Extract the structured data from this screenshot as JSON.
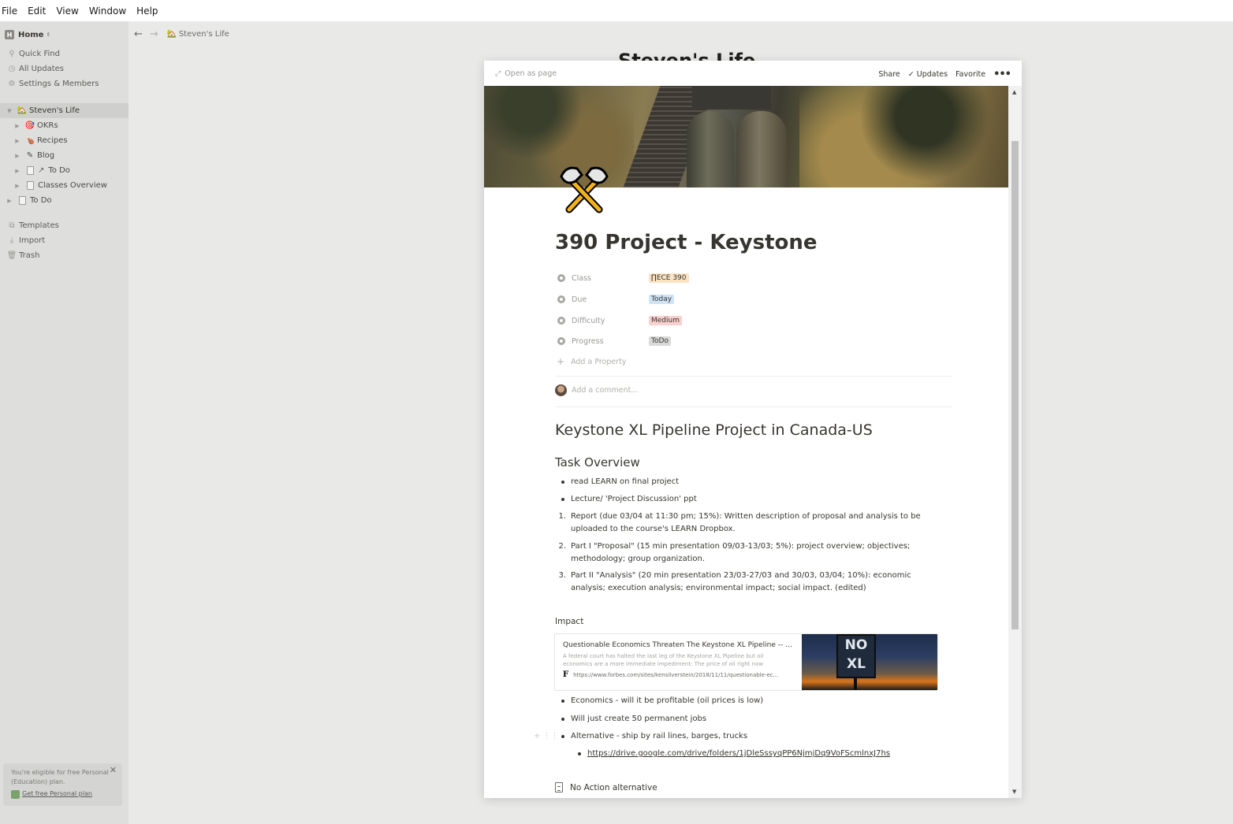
{
  "menubar": [
    "File",
    "Edit",
    "View",
    "Window",
    "Help"
  ],
  "sidebar": {
    "workspace": "Home",
    "items": [
      {
        "label": "Quick Find",
        "icon": "search-icon"
      },
      {
        "label": "All Updates",
        "icon": "clock-icon"
      },
      {
        "label": "Settings & Members",
        "icon": "gear-icon"
      }
    ],
    "tree": [
      {
        "label": "Steven's Life",
        "icon": "house-emoji",
        "active": true
      },
      {
        "label": "OKRs",
        "icon": "target-emoji"
      },
      {
        "label": "Recipes",
        "icon": "drumstick-emoji"
      },
      {
        "label": "Blog",
        "icon": "pencil-emoji"
      },
      {
        "label": "To Do",
        "icon": "page-icon"
      },
      {
        "label": "Classes Overview",
        "icon": "page-icon"
      },
      {
        "label": "To Do",
        "icon": "page-icon"
      }
    ],
    "bottom": [
      {
        "label": "Templates",
        "icon": "templates-icon"
      },
      {
        "label": "Import",
        "icon": "import-icon"
      },
      {
        "label": "Trash",
        "icon": "trash-icon"
      }
    ],
    "promo": {
      "text": "You're eligible for free Personal (Education) plan.",
      "link": "Get free Personal plan"
    }
  },
  "topbar": {
    "breadcrumb": "Steven's Life"
  },
  "background_title": "Steven's Life",
  "modal": {
    "open_as_page": "Open as page",
    "share": "Share",
    "updates": "Updates",
    "favorite": "Favorite",
    "title": "390 Project - Keystone",
    "properties": [
      {
        "name": "Class",
        "value": "ECE 390",
        "color": "#fae3c5"
      },
      {
        "name": "Due",
        "value": "Today",
        "color": "#cfe3f6"
      },
      {
        "name": "Difficulty",
        "value": "Medium",
        "color": "#f8d0cf"
      },
      {
        "name": "Progress",
        "value": "ToDo",
        "color": "#d9d9d7"
      }
    ],
    "add_property": "Add a Property",
    "comment_placeholder": "Add a comment...",
    "heading1": "Keystone XL Pipeline Project in Canada-US",
    "heading2": "Task Overview",
    "bullets": [
      "read LEARN on final project",
      "Lecture/ 'Project Discussion' ppt"
    ],
    "numbered": [
      "Report (due 03/04 at 11:30 pm; 15%): Written description of proposal and analysis to be uploaded to the course's LEARN Dropbox.",
      "Part I \"Proposal\" (15 min presentation  09/03-13/03; 5%): project overview; objectives; methodology; group organization.",
      "Part II \"Analysis\" (20 min presentation 23/03-27/03 and 30/03, 03/04; 10%): economic analysis; execution analysis; environmental impact; social impact. (edited)"
    ],
    "impact_label": "Impact",
    "bookmark": {
      "title": "Questionable Economics Threaten The Keystone XL Pipeline -- No...",
      "description": "A federal court has halted the last leg of the Keystone XL Pipeline but oil economics are a more immediate impediment: The price of oil right now",
      "url": "https://www.forbes.com/sites/kensilverstein/2018/11/11/questionable-ec...",
      "sign_line1": "NO",
      "sign_line2": "XL"
    },
    "impact_bullets": [
      "Economics - will it be profitable (oil prices is low)",
      "Will just create 50 permanent jobs",
      "Alternative - ship by rail lines, barges, trucks"
    ],
    "nested_link": "https://drive.google.com/drive/folders/1jDleSssyqPP6NjmjDq9VoFScmlnxJ7hs",
    "subpage": "No Action alternative"
  }
}
